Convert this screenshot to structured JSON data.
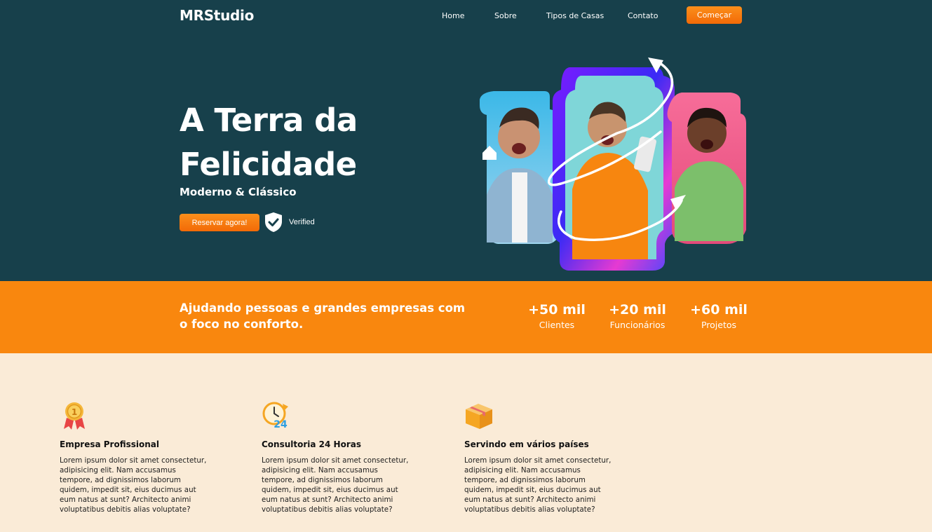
{
  "header": {
    "logo": "MRStudio",
    "nav": [
      "Home",
      "Sobre",
      "Tipos de Casas",
      "Contato"
    ],
    "cta": "Começar"
  },
  "hero": {
    "title": "A Terra da Felicidade",
    "subtitle": "Moderno & Clássico",
    "book_button": "Reservar agora!",
    "verified_label": "Verified"
  },
  "band": {
    "text": "Ajudando pessoas e grandes empresas com o foco no conforto.",
    "stats": [
      {
        "value": "+50 mil",
        "label": "Clientes"
      },
      {
        "value": "+20 mil",
        "label": "Funcionários"
      },
      {
        "value": "+60 mil",
        "label": "Projetos"
      }
    ]
  },
  "features": [
    {
      "icon": "medal-icon",
      "title": "Empresa Profissional",
      "text": "Lorem ipsum dolor sit amet consectetur, adipisicing elit. Nam accusamus tempore, ad dignissimos laborum quidem, impedit sit, eius ducimus aut eum natus at sunt? Architecto animi voluptatibus debitis alias voluptate?"
    },
    {
      "icon": "clock-24-icon",
      "title": "Consultoria 24 Horas",
      "text": "Lorem ipsum dolor sit amet consectetur, adipisicing elit. Nam accusamus tempore, ad dignissimos laborum quidem, impedit sit, eius ducimus aut eum natus at sunt? Architecto animi voluptatibus debitis alias voluptate?"
    },
    {
      "icon": "box-icon",
      "title": "Servindo em vários países",
      "text": "Lorem ipsum dolor sit amet consectetur, adipisicing elit. Nam accusamus tempore, ad dignissimos laborum quidem, impedit sit, eius ducimus aut eum natus at sunt? Architecto animi voluptatibus debitis alias voluptate?"
    }
  ],
  "colors": {
    "hero_bg": "#17404b",
    "accent": "#f9870e",
    "page_bg": "#faebd7"
  }
}
